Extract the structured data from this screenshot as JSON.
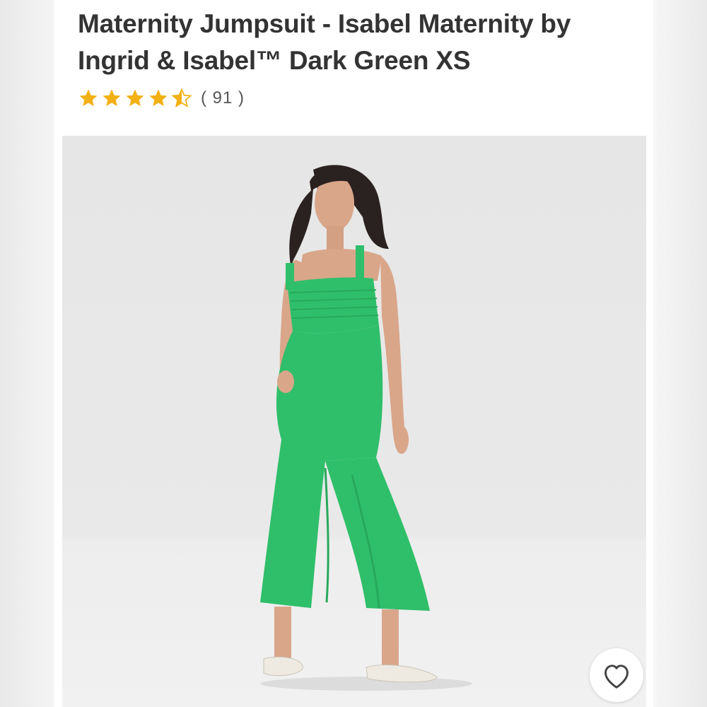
{
  "product": {
    "title": "Maternity Jumpsuit - Isabel Maternity by Ingrid & Isabel™ Dark Green XS",
    "rating": 4.5,
    "rating_max": 5,
    "review_count_text": "( 91 )"
  },
  "colors": {
    "star": "#f3b012",
    "title_text": "#333333",
    "jumpsuit": "#2fbf6a",
    "photo_bg": "#e8e8e8"
  },
  "icons": {
    "favorite": "heart-outline-icon",
    "rating_star": "star-icon"
  }
}
